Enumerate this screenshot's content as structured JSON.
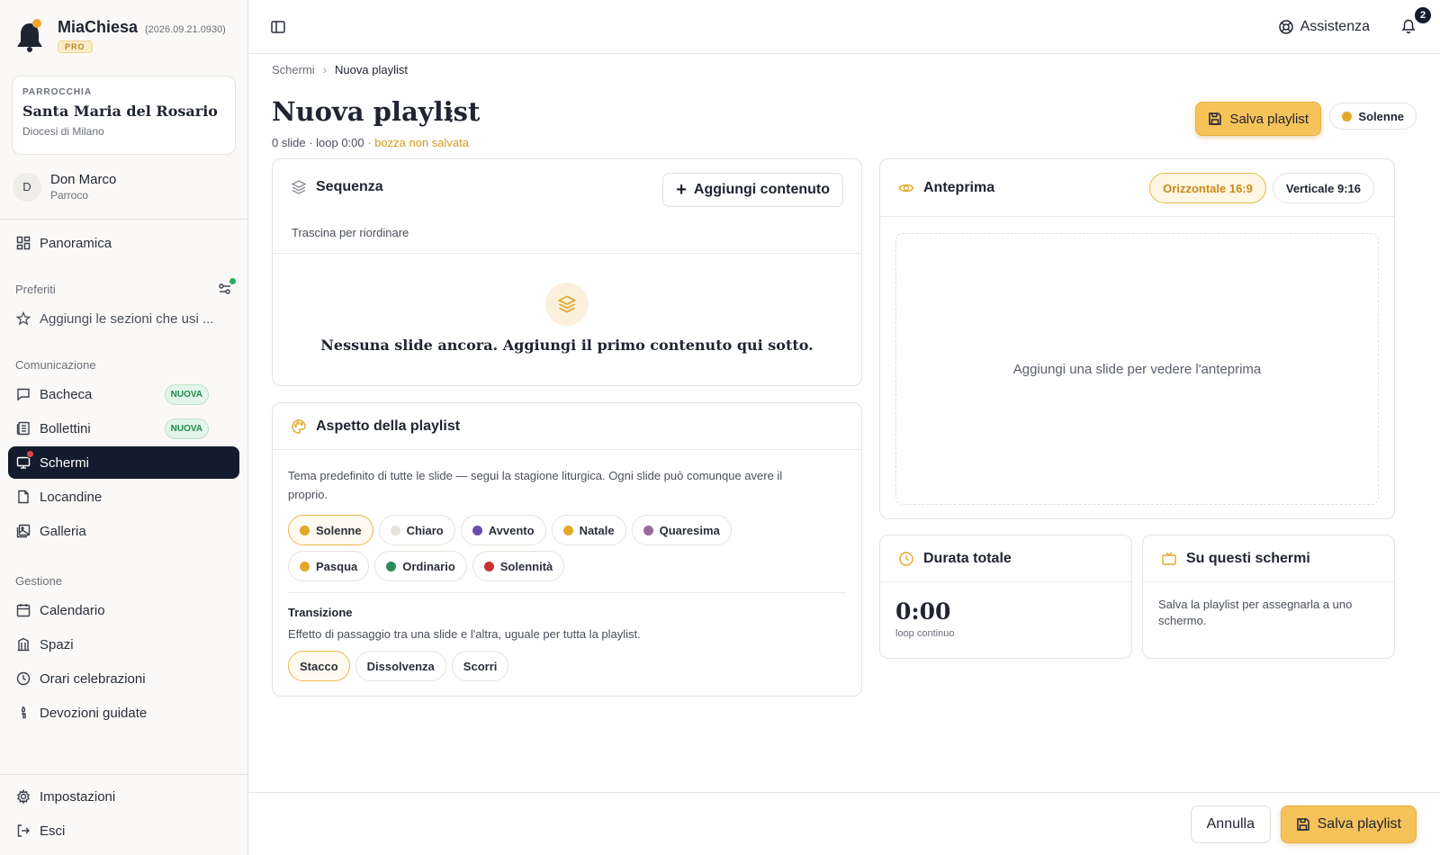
{
  "brand": {
    "name": "MiaChiesa",
    "version": "(2026.09.21.0930)",
    "tier": "PRO"
  },
  "parish": {
    "label": "PARROCCHIA",
    "name": "Santa Maria del Rosario",
    "diocese": "Diocesi di Milano"
  },
  "user": {
    "initial": "D",
    "name": "Don Marco",
    "role": "Parroco"
  },
  "nav": {
    "overview": "Panoramica",
    "favorites_label": "Preferiti",
    "favorites_add": "Aggiungi le sezioni che usi ...",
    "communication_label": "Comunicazione",
    "communication": [
      {
        "label": "Bacheca",
        "badge": "NUOVA"
      },
      {
        "label": "Bollettini",
        "badge": "NUOVA"
      },
      {
        "label": "Schermi"
      },
      {
        "label": "Locandine"
      },
      {
        "label": "Galleria"
      }
    ],
    "management_label": "Gestione",
    "management": [
      {
        "label": "Calendario"
      },
      {
        "label": "Spazi"
      },
      {
        "label": "Orari celebrazioni"
      },
      {
        "label": "Devozioni guidate"
      }
    ],
    "settings": "Impostazioni",
    "logout": "Esci"
  },
  "topbar": {
    "help": "Assistenza",
    "notifications": "2"
  },
  "breadcrumb": {
    "parent": "Schermi",
    "current": "Nuova playlist"
  },
  "page": {
    "title": "Nuova playlist",
    "meta": "0 slide · loop 0:00",
    "draft": "· bozza non salvata",
    "save_label": "Salva playlist",
    "season": "Solenne"
  },
  "sequence": {
    "title": "Sequenza",
    "add_label": "Aggiungi contenuto",
    "hint": "Trascina per riordinare",
    "empty": "Nessuna slide ancora. Aggiungi il primo contenuto qui sotto."
  },
  "appearance": {
    "title": "Aspetto della playlist",
    "description": "Tema predefinito di tutte le slide — segui la stagione liturgica. Ogni slide può comunque avere il proprio.",
    "themes": [
      {
        "label": "Solenne",
        "color": "#e2a82a"
      },
      {
        "label": "Chiaro",
        "color": "#e6e3dc"
      },
      {
        "label": "Avvento",
        "color": "#6b4bb0"
      },
      {
        "label": "Natale",
        "color": "#e2a82a"
      },
      {
        "label": "Quaresima",
        "color": "#9a6a9a"
      },
      {
        "label": "Pasqua",
        "color": "#e2a82a"
      },
      {
        "label": "Ordinario",
        "color": "#2f8a5a"
      },
      {
        "label": "Solennità",
        "color": "#c8302c"
      }
    ],
    "transition_title": "Transizione",
    "transition_desc": "Effetto di passaggio tra una slide e l'altra, uguale per tutta la playlist.",
    "transitions": [
      "Stacco",
      "Dissolvenza",
      "Scorri"
    ]
  },
  "preview": {
    "title": "Anteprima",
    "landscape": "Orizzontale 16:9",
    "portrait": "Verticale 9:16",
    "empty": "Aggiungi una slide per vedere l'anteprima"
  },
  "duration": {
    "title": "Durata totale",
    "value": "0:00",
    "note": "loop continuo"
  },
  "screens": {
    "title": "Su questi schermi",
    "note": "Salva la playlist per assegnarla a uno schermo."
  },
  "footer": {
    "cancel": "Annulla",
    "save": "Salva playlist"
  },
  "colors": {
    "accent": "#f6c25a",
    "dark": "#131b2e",
    "draft": "#d49a21"
  }
}
